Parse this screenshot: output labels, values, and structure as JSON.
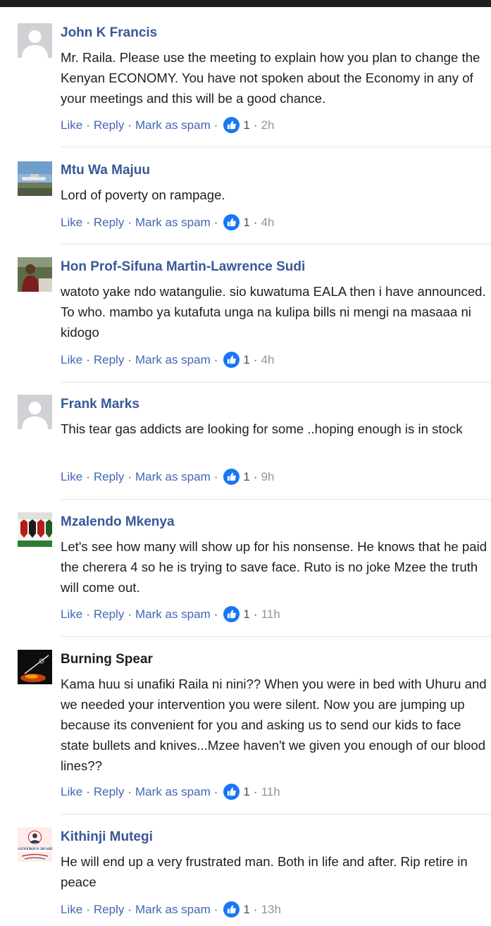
{
  "comments": [
    {
      "author": "John K Francis",
      "text": "Mr. Raila. Please use the meeting to explain how you plan to change the Kenyan ECONOMY. You have not spoken about the Economy in any of your meetings and this will be a good chance.",
      "likes": "1",
      "time": "2h",
      "avatar": "default-avatar"
    },
    {
      "author": "Mtu Wa Majuu",
      "text": "Lord of poverty on rampage.",
      "likes": "1",
      "time": "4h",
      "avatar": "airplane-photo"
    },
    {
      "author": "Hon Prof-Sifuna Martin-Lawrence Sudi",
      "text": "watoto yake ndo watangulie. sio kuwatuma EALA then i have announced. To who. mambo ya kutafuta unga na kulipa bills ni mengi na masaaa ni kidogo",
      "likes": "1",
      "time": "4h",
      "avatar": "person-photo"
    },
    {
      "author": "Frank Marks",
      "text": "This tear gas addicts are looking for some ..hoping enough is in stock",
      "likes": "1",
      "time": "9h",
      "avatar": "default-avatar"
    },
    {
      "author": "Mzalendo Mkenya",
      "text": "Let's see how many will show up for his nonsense. He knows that he paid the cherera 4 so he is trying to save face. Ruto is no joke Mzee the truth will come out.",
      "likes": "1",
      "time": "11h",
      "avatar": "shields-photo"
    },
    {
      "author": "Burning Spear",
      "text": "Kama huu si unafiki Raila ni nini?? When you were in bed with Uhuru and we needed your intervention you were silent. Now you are jumping up because its convenient for you and asking us to send our kids to face state bullets and knives...Mzee haven't we given you enough of our blood lines??",
      "likes": "1",
      "time": "11h",
      "avatar": "spear-photo"
    },
    {
      "author": "Kithinji Mutegi",
      "text": "He will end up a very frustrated man. Both in life and after. Rip retire in peace",
      "likes": "1",
      "time": "13h",
      "avatar": "generous-heart-logo",
      "avatar_text": "GENEROUS HEART"
    }
  ],
  "actions": {
    "like": "Like",
    "reply": "Reply",
    "spam": "Mark as spam",
    "sep": "·"
  },
  "colors": {
    "link": "#385898",
    "action": "#4267b2",
    "like_badge": "#1877f2"
  }
}
